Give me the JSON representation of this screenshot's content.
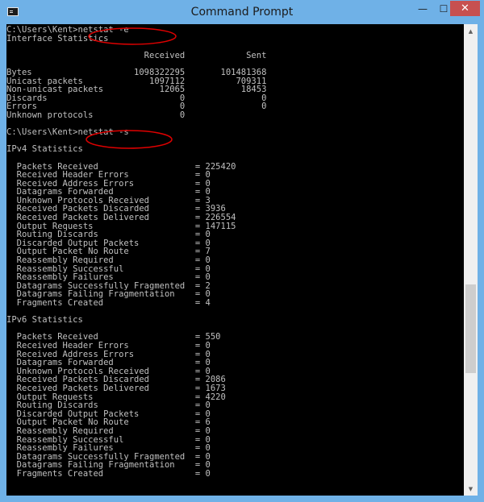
{
  "window": {
    "title": "Command Prompt"
  },
  "controls": {
    "minimize": "—",
    "maximize": "☐",
    "close": "✕"
  },
  "console": {
    "lines": [
      "C:\\Users\\Kent>netstat -e",
      "Interface Statistics",
      "",
      "                           Received            Sent",
      "",
      "Bytes                    1098322295       101481368",
      "Unicast packets             1097112          709311",
      "Non-unicast packets           12065           18453",
      "Discards                          0               0",
      "Errors                            0               0",
      "Unknown protocols                 0",
      "",
      "C:\\Users\\Kent>netstat -s",
      "",
      "IPv4 Statistics",
      "",
      "  Packets Received                   = 225420",
      "  Received Header Errors             = 0",
      "  Received Address Errors            = 0",
      "  Datagrams Forwarded                = 0",
      "  Unknown Protocols Received         = 3",
      "  Received Packets Discarded         = 3936",
      "  Received Packets Delivered         = 226554",
      "  Output Requests                    = 147115",
      "  Routing Discards                   = 0",
      "  Discarded Output Packets           = 0",
      "  Output Packet No Route             = 7",
      "  Reassembly Required                = 0",
      "  Reassembly Successful              = 0",
      "  Reassembly Failures                = 0",
      "  Datagrams Successfully Fragmented  = 2",
      "  Datagrams Failing Fragmentation    = 0",
      "  Fragments Created                  = 4",
      "",
      "IPv6 Statistics",
      "",
      "  Packets Received                   = 550",
      "  Received Header Errors             = 0",
      "  Received Address Errors            = 0",
      "  Datagrams Forwarded                = 0",
      "  Unknown Protocols Received         = 0",
      "  Received Packets Discarded         = 2086",
      "  Received Packets Delivered         = 1673",
      "  Output Requests                    = 4220",
      "  Routing Discards                   = 0",
      "  Discarded Output Packets           = 0",
      "  Output Packet No Route             = 6",
      "  Reassembly Required                = 0",
      "  Reassembly Successful              = 0",
      "  Reassembly Failures                = 0",
      "  Datagrams Successfully Fragmented  = 0",
      "  Datagrams Failing Fragmentation    = 0",
      "  Fragments Created                  = 0"
    ]
  },
  "colors": {
    "titlebar": "#6fb1e7",
    "console_bg": "#000000",
    "console_text": "#c0c0c0",
    "annotation": "#e00000",
    "close_button": "#c75050"
  },
  "icons": {
    "app": "console-icon",
    "scroll_up": "arrow-up-icon",
    "scroll_down": "arrow-down-icon"
  },
  "scroll": {
    "position_fraction": 0.57,
    "visible_fraction": 0.19
  }
}
